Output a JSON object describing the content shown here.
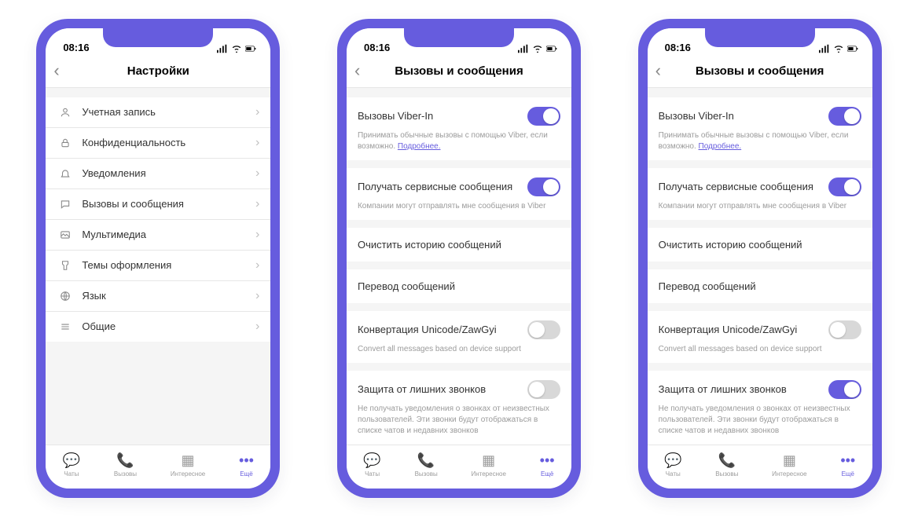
{
  "status_time": "08:16",
  "screen1": {
    "title": "Настройки",
    "items": [
      {
        "icon": "person",
        "label": "Учетная запись"
      },
      {
        "icon": "lock",
        "label": "Конфиденциальность"
      },
      {
        "icon": "bell",
        "label": "Уведомления"
      },
      {
        "icon": "chat",
        "label": "Вызовы и сообщения"
      },
      {
        "icon": "media",
        "label": "Мультимедиа"
      },
      {
        "icon": "theme",
        "label": "Темы оформления"
      },
      {
        "icon": "globe",
        "label": "Язык"
      },
      {
        "icon": "list",
        "label": "Общие"
      }
    ]
  },
  "screen2": {
    "title": "Вызовы и сообщения",
    "viber_in": {
      "label": "Вызовы Viber-In",
      "desc": "Принимать обычные вызовы с помощью Viber, если возможно. ",
      "link": "Подробнее.",
      "on": true
    },
    "service_msg": {
      "label": "Получать сервисные сообщения",
      "desc": "Компании могут отправлять мне сообщения в Viber",
      "on": true
    },
    "clear_history": {
      "label": "Очистить историю сообщений"
    },
    "translate": {
      "label": "Перевод сообщений"
    },
    "unicode": {
      "label": "Конвертация Unicode/ZawGyi",
      "desc": "Convert all messages based on device support",
      "on": false
    },
    "spam": {
      "label": "Защита от лишних звонков",
      "desc": "Не получать уведомления о звонках от неизвестных пользователей. Эти звонки будут отображаться в списке чатов и недавних звонков",
      "on": false
    }
  },
  "screen3": {
    "title": "Вызовы и сообщения",
    "spam_on": true
  },
  "tabs": [
    {
      "label": "Чаты"
    },
    {
      "label": "Вызовы"
    },
    {
      "label": "Интересное"
    },
    {
      "label": "Ещё"
    }
  ]
}
